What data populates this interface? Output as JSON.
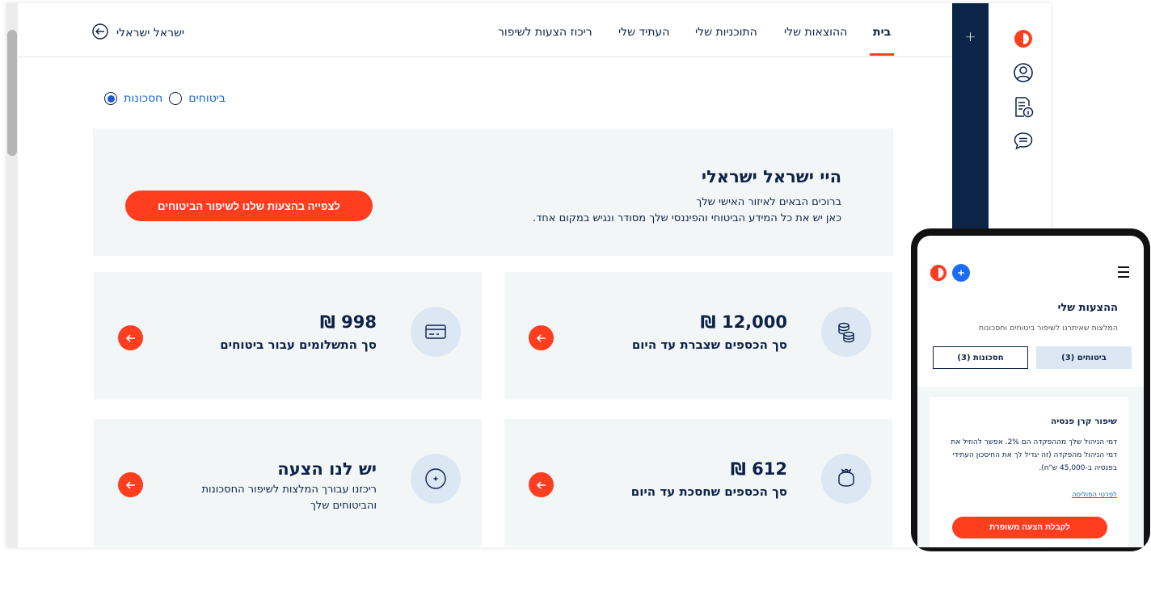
{
  "header": {
    "nav": [
      {
        "label": "בית",
        "active": true
      },
      {
        "label": "ההוצאות שלי",
        "active": false
      },
      {
        "label": "התוכניות שלי",
        "active": false
      },
      {
        "label": "העתיד שלי",
        "active": false
      },
      {
        "label": "ריכוז הצעות לשיפור",
        "active": false
      }
    ],
    "user_name": "ישראל ישראלי",
    "logout_icon": "logout-arrow-icon"
  },
  "sidebar": {
    "icons": [
      "brand-logo-icon",
      "user-profile-icon",
      "document-info-icon",
      "chat-icon"
    ],
    "add_label": "+"
  },
  "filter": {
    "options": [
      {
        "label": "ביטוחים",
        "selected": false
      },
      {
        "label": "חסכונות",
        "selected": true
      }
    ]
  },
  "hero": {
    "title": "היי ישראל ישראלי",
    "line1": "ברוכים הבאים לאיזור האישי שלך",
    "line2": "כאן יש את כל המידע הביטוחי והפיננסי שלך מסודר ונגיש במקום אחד.",
    "button": "לצפייה בהצעות שלנו לשיפור הביטוחים"
  },
  "cards": [
    {
      "value": "12,000 ₪",
      "label": "סך הכספים שצברת עד היום",
      "icon": "coins-icon"
    },
    {
      "value": "998 ₪",
      "label": "סך התשלומים עבור ביטוחים",
      "icon": "credit-card-icon"
    },
    {
      "value": "612 ₪",
      "label": "סך הכספים שחסכת עד היום",
      "icon": "piggy-bank-icon"
    },
    {
      "value": "יש לנו הצעה",
      "desc": "ריכזנו עבורך המלצות לשיפור החסכונות והביטוחים שלך",
      "icon": "plus-circle-icon"
    }
  ],
  "colors": {
    "navy": "#0c2448",
    "accent": "#ff3d1f",
    "card_bg": "#f3f6f7",
    "icon_bg": "#dbe7f2",
    "link": "#1964d9"
  },
  "mobile": {
    "title": "ההצעות שלי",
    "subtitle": "המלצות שאיתרנו לשיפור ביטוחים וחסכונות",
    "tabs": [
      {
        "label": "ביטוחים (3)",
        "selected": true
      },
      {
        "label": "חסכונות (3)",
        "selected": false
      }
    ],
    "card": {
      "title": "שיפור קרן פנסיה",
      "text": "דמי הניהול שלך מההפקדה הם 2%. אפשר להוזיל את דמי הניהול מהפקדה (זה יגדיל לך את החיסכון העתידי בפנסיה ב-45,000 ש\"ח).",
      "link": "לפרטי הפוליסה",
      "button": "לקבלת הצעה משופרת"
    }
  }
}
